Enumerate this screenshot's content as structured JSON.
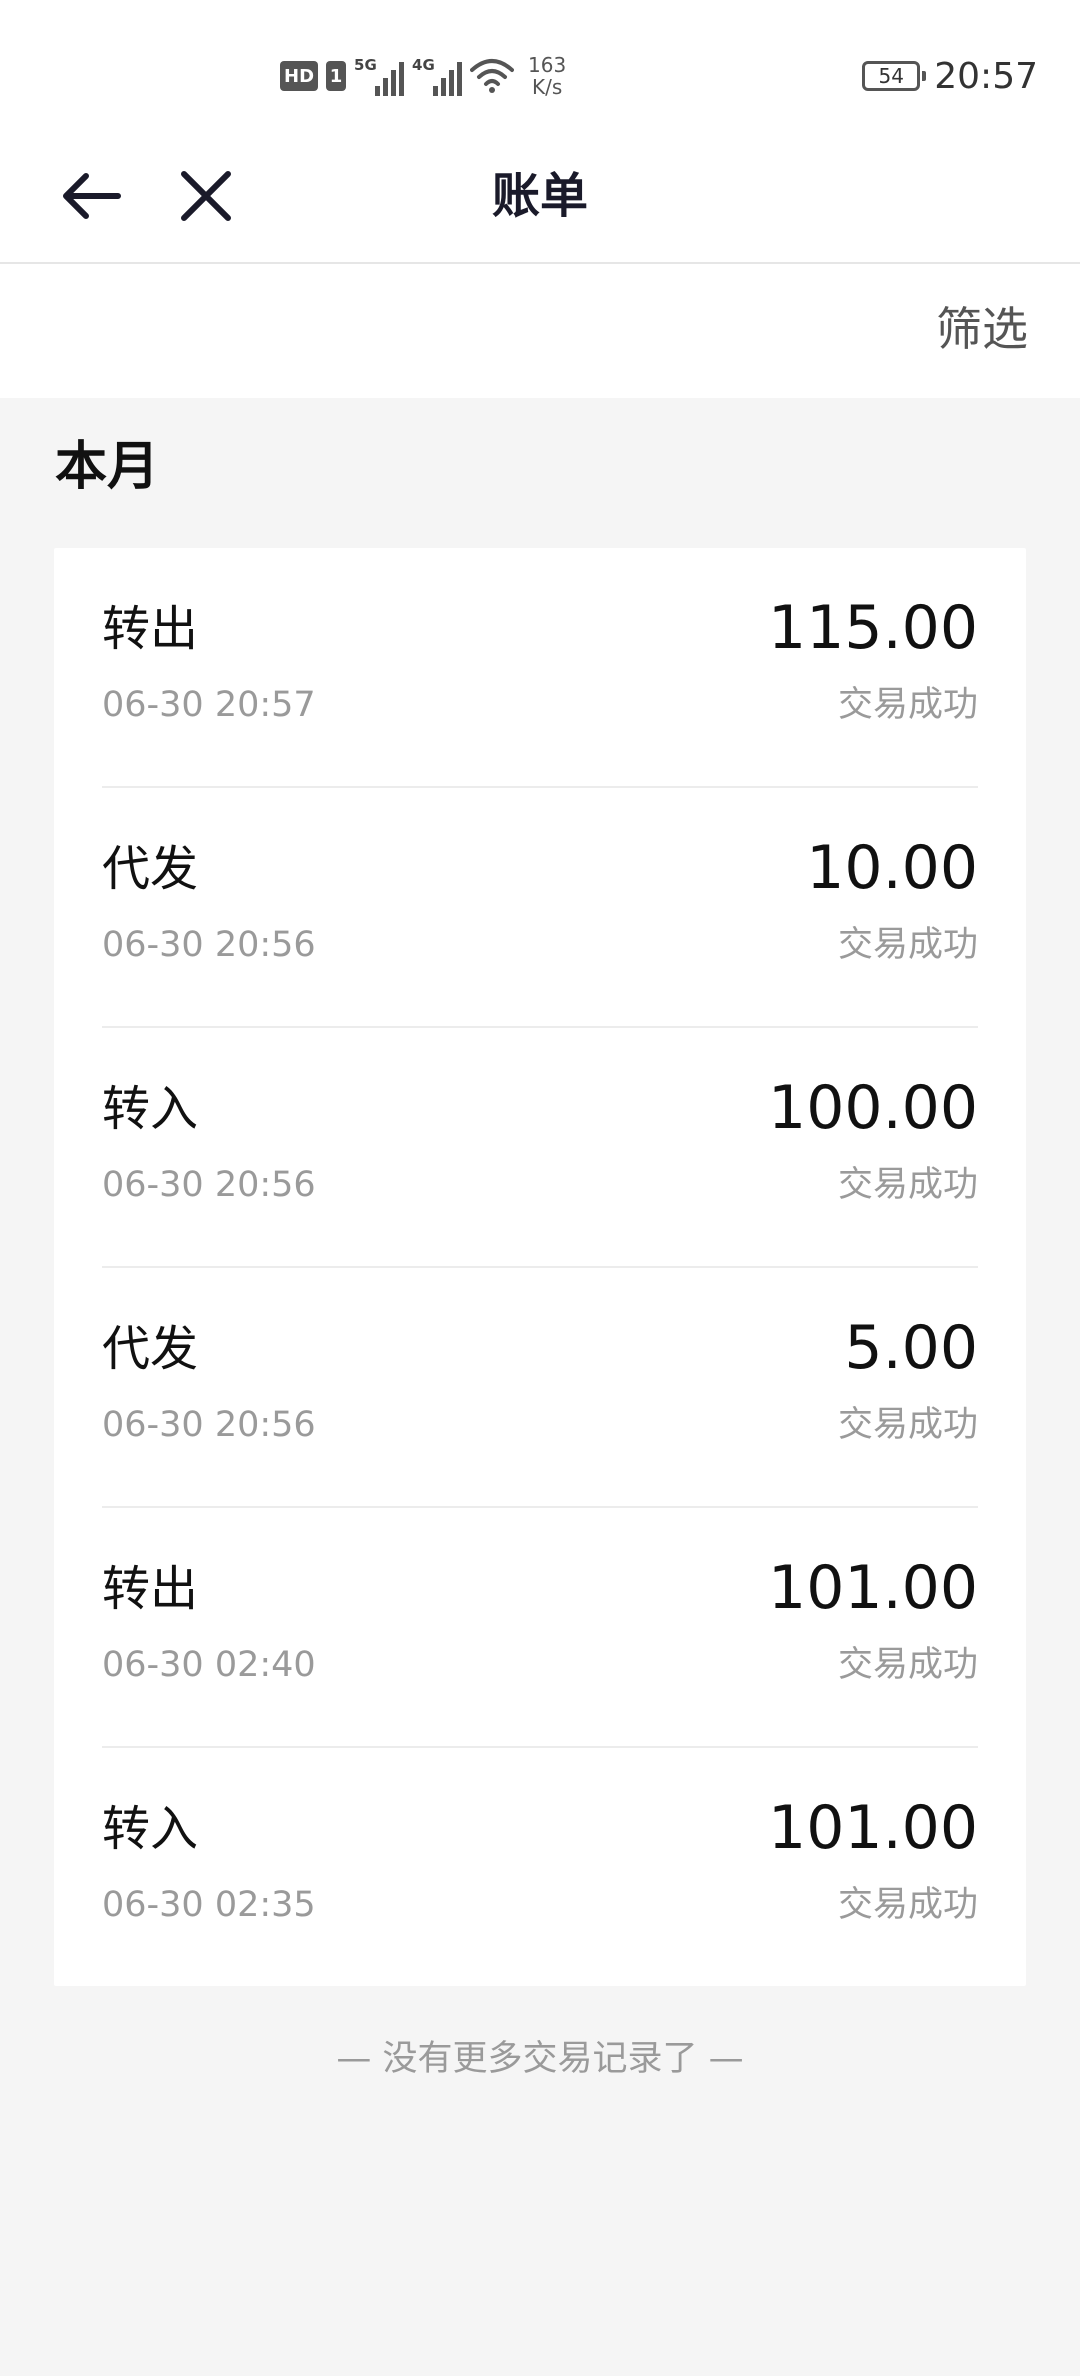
{
  "status_bar": {
    "hd": "HD",
    "sim": "1",
    "net1": "5G",
    "net2": "4G",
    "speed_value": "163",
    "speed_unit": "K/s",
    "battery": "54",
    "time": "20:57"
  },
  "nav": {
    "back_icon": "arrow-left-icon",
    "close_icon": "close-icon",
    "title": "账单"
  },
  "filter": {
    "label": "筛选"
  },
  "section": {
    "title": "本月"
  },
  "transactions": [
    {
      "type": "转出",
      "time": "06-30 20:57",
      "amount": "115.00",
      "status": "交易成功"
    },
    {
      "type": "代发",
      "time": "06-30 20:56",
      "amount": "10.00",
      "status": "交易成功"
    },
    {
      "type": "转入",
      "time": "06-30 20:56",
      "amount": "100.00",
      "status": "交易成功"
    },
    {
      "type": "代发",
      "time": "06-30 20:56",
      "amount": "5.00",
      "status": "交易成功"
    },
    {
      "type": "转出",
      "time": "06-30 02:40",
      "amount": "101.00",
      "status": "交易成功"
    },
    {
      "type": "转入",
      "time": "06-30 02:35",
      "amount": "101.00",
      "status": "交易成功"
    }
  ],
  "footer": {
    "no_more": "— 没有更多交易记录了 —"
  }
}
